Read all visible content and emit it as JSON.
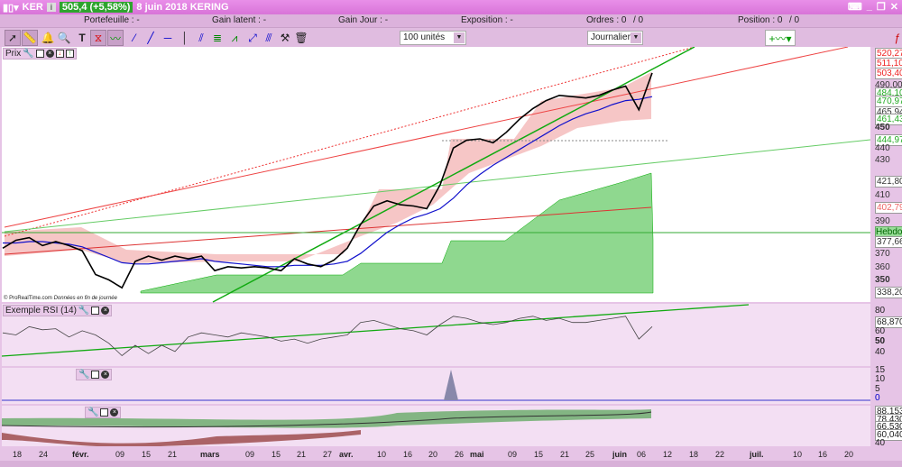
{
  "title": {
    "symbol": "KER",
    "price_change": "505,4 (+5,58%)",
    "date_name": "8 juin 2018 KERING"
  },
  "infobar": {
    "portefeuille": "Portefeuille : -",
    "gain_latent": "Gain latent : -",
    "gain_jour": "Gain Jour : -",
    "exposition": "Exposition : -",
    "ordres": "Ordres : 0",
    "ordres2": "/ 0",
    "position": "Position : 0",
    "position2": "/ 0"
  },
  "toolbar": {
    "quantity": "100 unités",
    "period": "Journalier"
  },
  "panels": {
    "price": "Prix",
    "rsi": "Exemple RSI (14)",
    "credit": "© ProRealTime.com",
    "credit2": "Données en fin de journée"
  },
  "price_axis": [
    "520,27",
    "511,10",
    "503,40",
    "490,00",
    "484,10",
    "470,97",
    "465,94",
    "461,43",
    "450",
    "444,97",
    "440",
    "430",
    "421,80",
    "410",
    "402,79",
    "390",
    "Hebdo",
    "377,66",
    "370",
    "360",
    "350",
    "338,20"
  ],
  "rsi_axis": [
    "80",
    "68,870",
    "60",
    "50",
    "40"
  ],
  "vol_axis": [
    "15",
    "10",
    "5",
    "0"
  ],
  "osc_axis": [
    "88,153",
    "78,430",
    "66,530",
    "60,040",
    "40"
  ],
  "xaxis": [
    "18",
    "24",
    "févr.",
    "09",
    "15",
    "21",
    "mars",
    "09",
    "15",
    "21",
    "27",
    "avr.",
    "10",
    "16",
    "20",
    "26",
    "mai",
    "09",
    "15",
    "21",
    "25",
    "juin",
    "06",
    "12",
    "18",
    "22",
    "juil.",
    "10",
    "16",
    "20"
  ],
  "chart_data": {
    "type": "line",
    "title": "KER Journalier",
    "price_range": [
      338,
      520
    ],
    "close": [
      372,
      378,
      380,
      374,
      377,
      374,
      370,
      352,
      348,
      342,
      362,
      366,
      363,
      366,
      364,
      366,
      355,
      358,
      357,
      358,
      357,
      355,
      364,
      360,
      358,
      363,
      372,
      390,
      404,
      408,
      405,
      404,
      402,
      420,
      448,
      454,
      455,
      452,
      460,
      470,
      478,
      484,
      488,
      487,
      486,
      488,
      492,
      495,
      477,
      505
    ],
    "ma_blue": [
      376,
      376,
      377,
      377,
      376,
      375,
      373,
      369,
      365,
      361,
      360,
      360,
      361,
      362,
      363,
      364,
      362,
      361,
      360,
      359,
      358,
      358,
      359,
      359,
      359,
      360,
      362,
      368,
      376,
      384,
      390,
      395,
      398,
      402,
      410,
      420,
      428,
      435,
      441,
      447,
      453,
      459,
      465,
      470,
      474,
      477,
      481,
      484,
      485,
      487
    ],
    "rsi": [
      62,
      60,
      68,
      65,
      66,
      58,
      64,
      60,
      52,
      40,
      50,
      42,
      50,
      44,
      58,
      62,
      60,
      58,
      62,
      60,
      58,
      54,
      56,
      52,
      56,
      58,
      60,
      72,
      74,
      70,
      66,
      64,
      60,
      70,
      78,
      76,
      72,
      70,
      72,
      76,
      78,
      74,
      76,
      72,
      72,
      74,
      76,
      78,
      56,
      68
    ],
    "rsi_range": [
      30,
      90
    ]
  }
}
